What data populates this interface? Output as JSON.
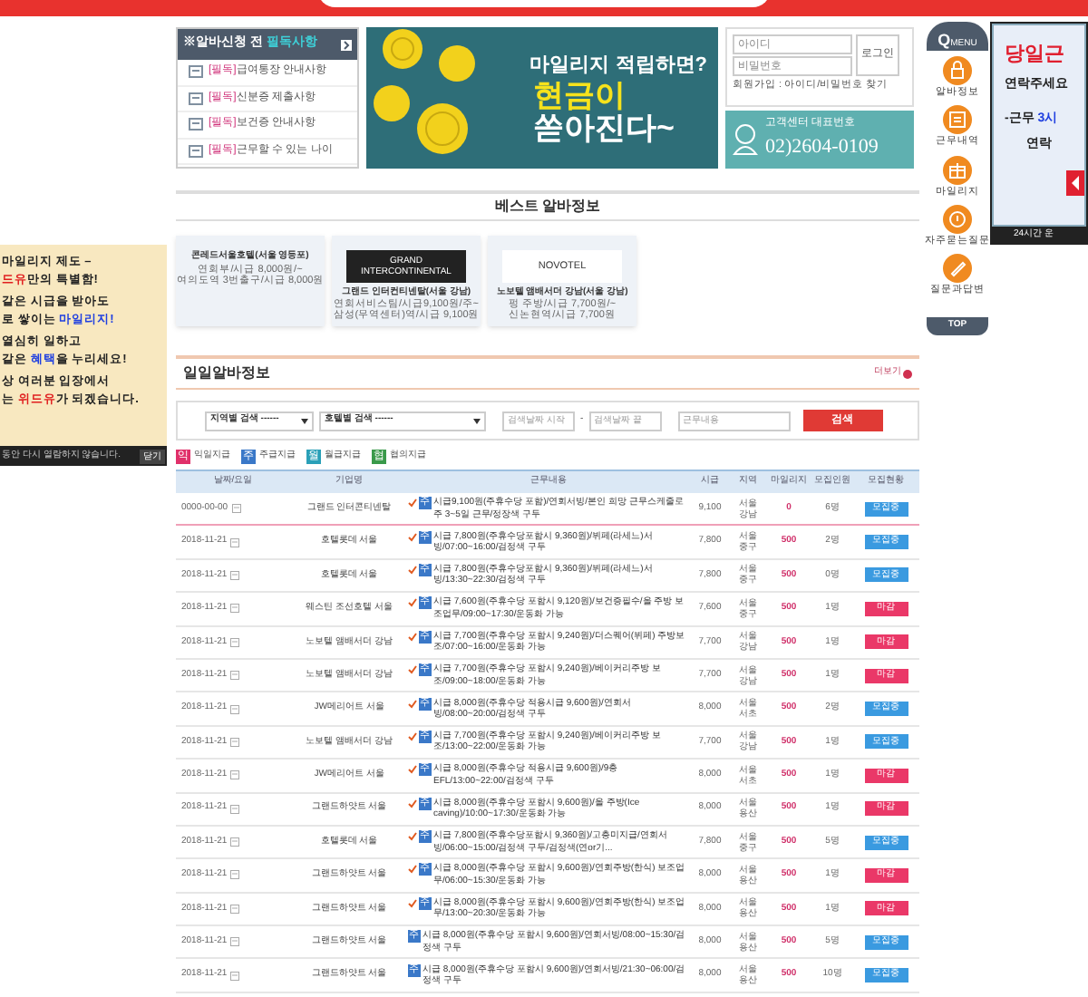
{
  "notice": {
    "title_prefix": "※알바신청 전 ",
    "title_highlight": "필독사항",
    "items": [
      {
        "tag": "[필독]",
        "text": "급여통장 안내사항"
      },
      {
        "tag": "[필독]",
        "text": "신분증 제출사항"
      },
      {
        "tag": "[필독]",
        "text": "보건증 안내사항"
      },
      {
        "tag": "[필독]",
        "text": "근무할 수 있는 나이"
      }
    ]
  },
  "banner": {
    "line1": "마일리지 적립하면?",
    "line2": "현금이",
    "line3": "쏟아진다~"
  },
  "login": {
    "id_placeholder": "아이디",
    "pw_placeholder": "비밀번호",
    "button": "로그인",
    "links": "회원가입 : 아이디/비밀번호 찾기"
  },
  "support": {
    "label": "고객센터 대표번호",
    "phone": "02)2604-0109"
  },
  "best": {
    "title": "베스트 알바정보",
    "cards": [
      {
        "kind": "text",
        "name": "콘레드서울호텔(서울 영등포)",
        "line1": "연회부/시급 8,000원/~",
        "line2": "여의도역 3번출구/시급 8,000원"
      },
      {
        "kind": "logo",
        "logo_top": "GRAND",
        "logo_main": "INTERCONTINENTAL",
        "name": "그랜드 인터컨티넨탈(서울 강남)",
        "line1": "연회서비스팀/시급9,100원/주~",
        "line2": "삼성(무역센터)역/시급 9,100원"
      },
      {
        "kind": "logo",
        "logo_main": "NOVOTEL",
        "name": "노보텔 앰배서더 강남(서울 강남)",
        "line1": "펑 주방/시급 7,700원/~",
        "line2": "신논현역/시급 7,700원"
      }
    ]
  },
  "daily": {
    "title": "일일알바정보",
    "more": "더보기"
  },
  "search": {
    "region": "지역별 검색 ------",
    "hotel": "호텔별 검색 ------",
    "date_start_placeholder": "검색날짜 시작",
    "dash": "-",
    "date_end_placeholder": "검색날짜 끝",
    "keyword_placeholder": "근무내용",
    "button": "검색"
  },
  "legend": [
    {
      "badge": "익",
      "label": "익일지급",
      "color": "#e0306a"
    },
    {
      "badge": "주",
      "label": "주급지급",
      "color": "#3a78c8"
    },
    {
      "badge": "월",
      "label": "월급지급",
      "color": "#2aa0b8"
    },
    {
      "badge": "협",
      "label": "협의지급",
      "color": "#3a9a4a"
    }
  ],
  "table": {
    "columns": [
      "날짜/요일",
      "기업명",
      "근무내용",
      "시급",
      "지역",
      "마일리지",
      "모집인원",
      "모집현황"
    ],
    "rows": [
      {
        "date": "0000-00-00",
        "company": "그랜드 인터콘티넨탈",
        "urgent": true,
        "pay_badge": {
          "kind": "weekly",
          "label": "주"
        },
        "content": "시급9,100원(주휴수당 포함)/연회서빙/본인 희망 근무스케줄로 주 3~5일 근무/정장색 구두",
        "wage": "9,100",
        "city": "서울",
        "district": "강남",
        "mileage": "0",
        "headcount": "6명",
        "status": "모집중",
        "kind": "open"
      },
      {
        "date": "2018-11-21",
        "company": "호텔롯데 서울",
        "urgent": true,
        "pay_badge": {
          "kind": "weekly",
          "label": "주"
        },
        "content": "시급 7,800원(주휴수당포함시 9,360원)/뷔페(라세느)서빙/07:00~16:00/검정색 구두",
        "wage": "7,800",
        "city": "서울",
        "district": "중구",
        "mileage": "500",
        "headcount": "2명",
        "status": "모집중",
        "kind": "open"
      },
      {
        "date": "2018-11-21",
        "company": "호텔롯데 서울",
        "urgent": true,
        "pay_badge": {
          "kind": "weekly",
          "label": "주"
        },
        "content": "시급 7,800원(주휴수당포함시 9,360원)/뷔페(라세느)서빙/13:30~22:30/검정색 구두",
        "wage": "7,800",
        "city": "서울",
        "district": "중구",
        "mileage": "500",
        "headcount": "0명",
        "status": "모집중",
        "kind": "open"
      },
      {
        "date": "2018-11-21",
        "company": "웨스틴 조선호텔 서울",
        "urgent": true,
        "pay_badge": {
          "kind": "weekly",
          "label": "주"
        },
        "content": "시급 7,600원(주휴수당 포함시 9,120원)/보건증필수/올 주방 보조업무/09:00~17:30/운동화 가능",
        "wage": "7,600",
        "city": "서울",
        "district": "중구",
        "mileage": "500",
        "headcount": "1명",
        "status": "마감",
        "kind": "closed"
      },
      {
        "date": "2018-11-21",
        "company": "노보텔 앰배서더 강남",
        "urgent": true,
        "pay_badge": {
          "kind": "weekly",
          "label": "주"
        },
        "content": "시급 7,700원(주휴수당 포함시 9,240원)/더스퀘어(뷔페) 주방보조/07:00~16:00/운동화 가능",
        "wage": "7,700",
        "city": "서울",
        "district": "강남",
        "mileage": "500",
        "headcount": "1명",
        "status": "마감",
        "kind": "closed"
      },
      {
        "date": "2018-11-21",
        "company": "노보텔 앰배서더 강남",
        "urgent": true,
        "pay_badge": {
          "kind": "weekly",
          "label": "주"
        },
        "content": "시급 7,700원(주휴수당 포함시 9,240원)/베이커리주방 보조/09:00~18:00/운동화 가능",
        "wage": "7,700",
        "city": "서울",
        "district": "강남",
        "mileage": "500",
        "headcount": "1명",
        "status": "마감",
        "kind": "closed"
      },
      {
        "date": "2018-11-21",
        "company": "JW메리어트 서울",
        "urgent": true,
        "pay_badge": {
          "kind": "weekly",
          "label": "주"
        },
        "content": "시급 8,000원(주휴수당 적용시급 9,600원)/연회서빙/08:00~20:00/검정색 구두",
        "wage": "8,000",
        "city": "서울",
        "district": "서초",
        "mileage": "500",
        "headcount": "2명",
        "status": "모집중",
        "kind": "open"
      },
      {
        "date": "2018-11-21",
        "company": "노보텔 앰배서더 강남",
        "urgent": true,
        "pay_badge": {
          "kind": "weekly",
          "label": "주"
        },
        "content": "시급 7,700원(주휴수당 포함시 9,240원)/베이커리주방 보조/13:00~22:00/운동화 가능",
        "wage": "7,700",
        "city": "서울",
        "district": "강남",
        "mileage": "500",
        "headcount": "1명",
        "status": "모집중",
        "kind": "open"
      },
      {
        "date": "2018-11-21",
        "company": "JW메리어트 서울",
        "urgent": true,
        "pay_badge": {
          "kind": "weekly",
          "label": "주"
        },
        "content": "시급 8,000원(주휴수당 적용시급 9,600원)/9층 EFL/13:00~22:00/검정색 구두",
        "wage": "8,000",
        "city": "서울",
        "district": "서초",
        "mileage": "500",
        "headcount": "1명",
        "status": "마감",
        "kind": "closed"
      },
      {
        "date": "2018-11-21",
        "company": "그랜드하얏트 서울",
        "urgent": true,
        "pay_badge": {
          "kind": "weekly",
          "label": "주"
        },
        "content": "시급 8,000원(주휴수당 포함시 9,600원)/올 주방(Ice caving)/10:00~17:30/운동화 가능",
        "wage": "8,000",
        "city": "서울",
        "district": "용산",
        "mileage": "500",
        "headcount": "1명",
        "status": "마감",
        "kind": "closed"
      },
      {
        "date": "2018-11-21",
        "company": "호텔롯데 서울",
        "urgent": true,
        "pay_badge": {
          "kind": "weekly",
          "label": "주"
        },
        "content": "시급 7,800원(주휴수당포함시 9,360원)/고층미지급/연회서빙/06:00~15:00/검정색 구두/검정색(연or기...",
        "wage": "7,800",
        "city": "서울",
        "district": "중구",
        "mileage": "500",
        "headcount": "5명",
        "status": "모집중",
        "kind": "open"
      },
      {
        "date": "2018-11-21",
        "company": "그랜드하얏트 서울",
        "urgent": true,
        "pay_badge": {
          "kind": "weekly",
          "label": "주"
        },
        "content": "시급 8,000원(주휴수당 포함시 9,600원)/연회주방(한식) 보조업무/06:00~15:30/운동화 가능",
        "wage": "8,000",
        "city": "서울",
        "district": "용산",
        "mileage": "500",
        "headcount": "1명",
        "status": "마감",
        "kind": "closed"
      },
      {
        "date": "2018-11-21",
        "company": "그랜드하얏트 서울",
        "urgent": true,
        "pay_badge": {
          "kind": "weekly",
          "label": "주"
        },
        "content": "시급 8,000원(주휴수당 포함시 9,600원)/연회주방(한식) 보조업무/13:00~20:30/운동화 가능",
        "wage": "8,000",
        "city": "서울",
        "district": "용산",
        "mileage": "500",
        "headcount": "1명",
        "status": "마감",
        "kind": "closed"
      },
      {
        "date": "2018-11-21",
        "company": "그랜드하얏트 서울",
        "urgent": false,
        "pay_badge": {
          "kind": "weekly",
          "label": "주"
        },
        "content": "시급 8,000원(주휴수당 포함시 9,600원)/연회서빙/08:00~15:30/검정색 구두",
        "wage": "8,000",
        "city": "서울",
        "district": "용산",
        "mileage": "500",
        "headcount": "5명",
        "status": "모집중",
        "kind": "open"
      },
      {
        "date": "2018-11-21",
        "company": "그랜드하얏트 서울",
        "urgent": false,
        "pay_badge": {
          "kind": "weekly",
          "label": "주"
        },
        "content": "시급 8,000원(주휴수당 포함시 9,600원)/연회서빙/21:30~06:00/검정색 구두",
        "wage": "8,000",
        "city": "서울",
        "district": "용산",
        "mileage": "500",
        "headcount": "10명",
        "status": "모집중",
        "kind": "open"
      }
    ]
  },
  "left_ad": {
    "lines": [
      [
        {
          "text": "마일리지 제도 –",
          "kind": "plain"
        }
      ],
      [
        {
          "text": "드유",
          "kind": "red"
        },
        {
          "text": "만의 특별함!",
          "kind": "plain"
        }
      ],
      [
        {
          "text": "같은 시급을 받아도",
          "kind": "plain"
        }
      ],
      [
        {
          "text": "로 쌓이는 ",
          "kind": "plain"
        },
        {
          "text": "마일리지!",
          "kind": "blue"
        }
      ],
      [
        {
          "text": "열심히 일하고",
          "kind": "plain"
        }
      ],
      [
        {
          "text": "같은 ",
          "kind": "plain"
        },
        {
          "text": "혜택",
          "kind": "blue"
        },
        {
          "text": "을 누리세요!",
          "kind": "plain"
        }
      ],
      [
        {
          "text": "상 여러분 입장에서",
          "kind": "plain"
        }
      ],
      [
        {
          "text": "는 ",
          "kind": "plain"
        },
        {
          "text": "위드유",
          "kind": "red"
        },
        {
          "text": "가 되겠습니다.",
          "kind": "plain"
        }
      ]
    ],
    "footer": "동안 다시 열람하지 않습니다.",
    "close": "닫기"
  },
  "quick_menu": {
    "title": "Q",
    "title_small": "MENU",
    "items": [
      {
        "label": "알바정보"
      },
      {
        "label": "근무내역"
      },
      {
        "label": "마일리지"
      },
      {
        "label": "자주묻는질문"
      },
      {
        "label": "질문과답변"
      }
    ],
    "top": "TOP"
  },
  "right_ad": {
    "title": "당일근",
    "line1": "연락주세요",
    "line2_prefix": "-근무 ",
    "line2_highlight": "3시",
    "line3": "연락",
    "footer": "24시간 운"
  }
}
